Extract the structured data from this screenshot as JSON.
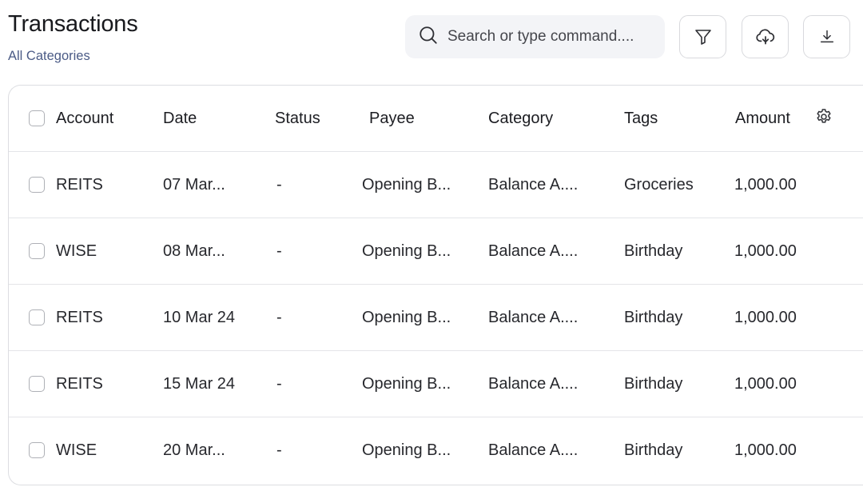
{
  "header": {
    "title": "Transactions",
    "subtitle": "All Categories"
  },
  "search": {
    "placeholder": "Search or type command...."
  },
  "toolbar": {
    "icons": [
      "search-icon",
      "filter-icon",
      "cloud-upload-icon",
      "download-icon",
      "gear-icon"
    ]
  },
  "table": {
    "columns": {
      "account": "Account",
      "date": "Date",
      "status": "Status",
      "payee": "Payee",
      "category": "Category",
      "tags": "Tags",
      "amount": "Amount"
    },
    "rows": [
      {
        "account": "REITS",
        "date": "07 Mar...",
        "status": "-",
        "payee": "Opening B...",
        "category": "Balance A....",
        "tags": "Groceries",
        "amount": "1,000.00"
      },
      {
        "account": "WISE",
        "date": "08 Mar...",
        "status": "-",
        "payee": "Opening B...",
        "category": "Balance A....",
        "tags": "Birthday",
        "amount": "1,000.00"
      },
      {
        "account": "REITS",
        "date": "10 Mar 24",
        "status": "-",
        "payee": "Opening B...",
        "category": "Balance A....",
        "tags": "Birthday",
        "amount": "1,000.00"
      },
      {
        "account": "REITS",
        "date": "15 Mar 24",
        "status": "-",
        "payee": "Opening B...",
        "category": "Balance A....",
        "tags": "Birthday",
        "amount": "1,000.00"
      },
      {
        "account": "WISE",
        "date": "20 Mar...",
        "status": "-",
        "payee": "Opening B...",
        "category": "Balance A....",
        "tags": "Birthday",
        "amount": "1,000.00"
      }
    ]
  },
  "colors": {
    "subtitle": "#4b5b86",
    "search_bg": "#f3f4f7",
    "border": "#dcdde1",
    "icon": "#2f3035"
  }
}
